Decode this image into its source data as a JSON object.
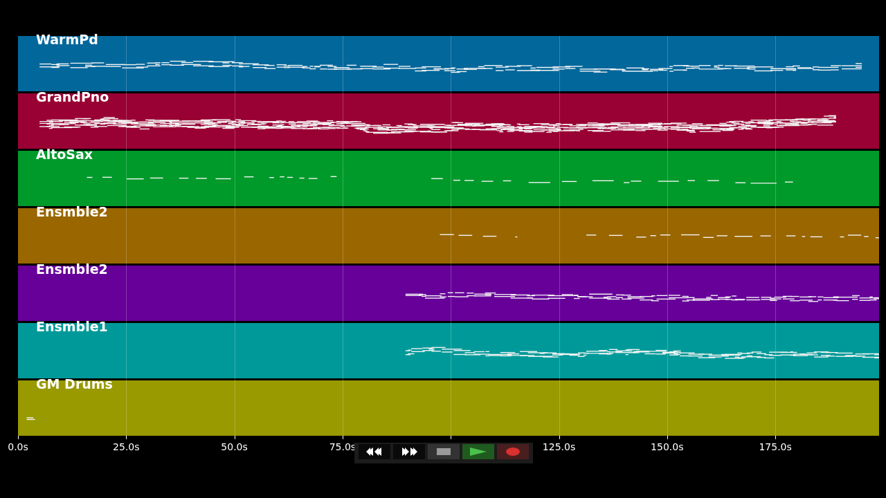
{
  "tracks": [
    {
      "name": "WarmPd",
      "color": "#02679b"
    },
    {
      "name": "GrandPno",
      "color": "#990033"
    },
    {
      "name": "AltoSax",
      "color": "#009a2a"
    },
    {
      "name": "Ensmble2",
      "color": "#996600"
    },
    {
      "name": "Ensmble2",
      "color": "#660099"
    },
    {
      "name": "Ensmble1",
      "color": "#009999"
    },
    {
      "name": "GM Drums",
      "color": "#999900"
    }
  ],
  "time_axis": {
    "ticks": [
      {
        "label": "0.0s"
      },
      {
        "label": "25.0s"
      },
      {
        "label": "50.0s"
      },
      {
        "label": "75.0s"
      },
      {
        "covered": true
      },
      {
        "label": "125.0s"
      },
      {
        "label": "150.0s"
      },
      {
        "label": "175.0s"
      }
    ]
  },
  "transport": [
    {
      "kind": "rewind"
    },
    {
      "kind": "forward"
    },
    {
      "kind": "stop"
    },
    {
      "kind": "play"
    },
    {
      "kind": "record"
    }
  ]
}
